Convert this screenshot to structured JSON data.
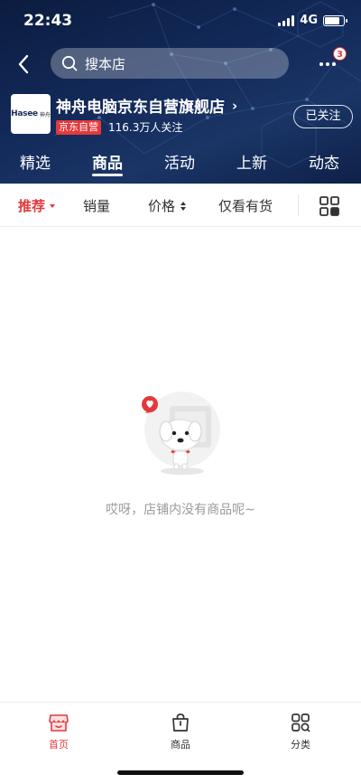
{
  "status_bar": {
    "time": "22:43",
    "network": "4G"
  },
  "header": {
    "search_placeholder": "搜本店",
    "message_badge": "3",
    "icons": {
      "back": "chevron-left-icon",
      "search": "search-icon",
      "more": "more-dots-icon"
    }
  },
  "shop": {
    "logo_text": "Hasee",
    "logo_subtext": "神舟",
    "name": "神舟电脑京东自营旗舰店",
    "chevron": "›",
    "self_operated_tag": "京东自营",
    "followers": "116.3万人关注",
    "follow_button": "已关注"
  },
  "tabs": [
    {
      "label": "精选",
      "active": false
    },
    {
      "label": "商品",
      "active": true
    },
    {
      "label": "活动",
      "active": false
    },
    {
      "label": "上新",
      "active": false
    },
    {
      "label": "动态",
      "active": false
    }
  ],
  "filters": {
    "recommend": "推荐",
    "sales": "销量",
    "price": "价格",
    "in_stock": "仅看有货",
    "active_color": "#e4393c"
  },
  "empty_state": {
    "message": "哎呀，店铺内没有商品呢~",
    "illustration": "jd-dog-mascot-icon"
  },
  "bottom_nav": [
    {
      "label": "首页",
      "icon": "storefront-icon",
      "active": true
    },
    {
      "label": "商品",
      "icon": "shopping-bag-icon",
      "active": false
    },
    {
      "label": "分类",
      "icon": "category-grid-icon",
      "active": false
    }
  ],
  "colors": {
    "brand_red": "#e4393c",
    "header_dark": "#0b1c3f"
  }
}
